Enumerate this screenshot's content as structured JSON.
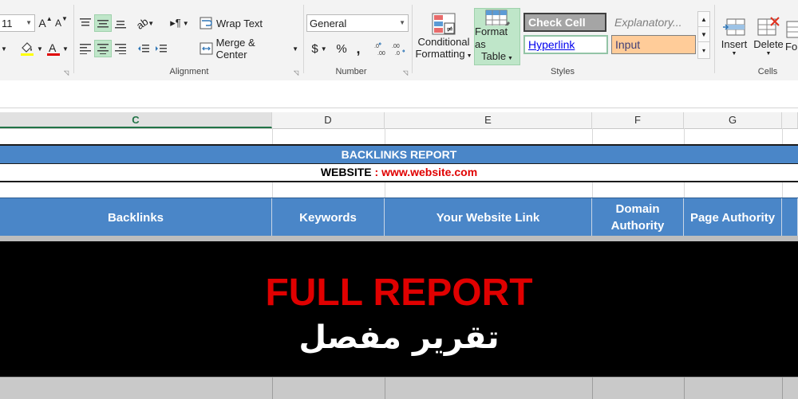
{
  "ribbon": {
    "font_size_value": "11",
    "groups": {
      "alignment": "Alignment",
      "number": "Number",
      "styles": "Styles",
      "cells": "Cells"
    },
    "alignment": {
      "wrap_text": "Wrap Text",
      "merge_center": "Merge & Center"
    },
    "number": {
      "format": "General",
      "currency": "$",
      "percent": "%",
      "comma": ","
    },
    "styles": {
      "conditional_formatting": [
        "Conditional",
        "Formatting"
      ],
      "format_as_table": [
        "Format as",
        "Table"
      ],
      "gallery": {
        "check_cell": "Check Cell",
        "explanatory": "Explanatory...",
        "hyperlink": "Hyperlink",
        "input": "Input"
      }
    },
    "cells": {
      "insert": "Insert",
      "delete": "Delete",
      "format": "For"
    },
    "colors": {
      "selected_green": "#bfe6c9",
      "input_fill": "#ffcc99",
      "check_cell_fill": "#a5a5a5",
      "hyperlink_color": "#0000ee"
    }
  },
  "columns": [
    "C",
    "D",
    "E",
    "F",
    "G"
  ],
  "selected_column": "C",
  "sheet": {
    "title": "BACKLINKS REPORT",
    "website_label": "WEBSITE",
    "website_sep": " : ",
    "website_value": "www.website.com",
    "headers": [
      "Backlinks",
      "Keywords",
      "Your Website Link",
      "Domain Authority",
      "Page Authority"
    ],
    "header_fill": "#4a86c8"
  },
  "overlay": {
    "title": "FULL REPORT",
    "subtitle": "تقرير مفصل",
    "title_color": "#e00000"
  }
}
